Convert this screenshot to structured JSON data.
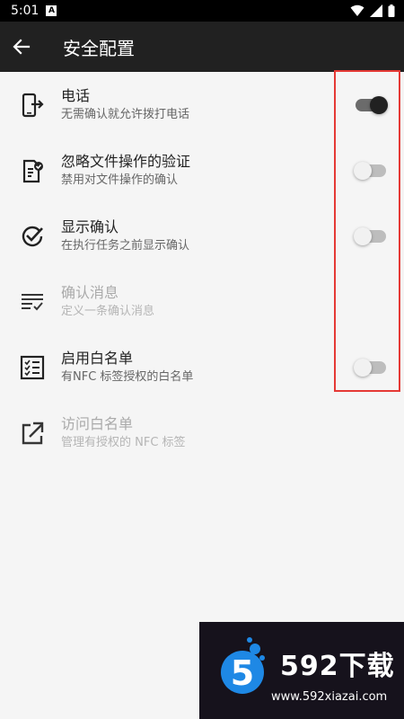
{
  "status_bar": {
    "time": "5:01",
    "app_icon_letter": "A"
  },
  "app_bar": {
    "title": "安全配置",
    "back_icon": "arrow-back-icon"
  },
  "settings": [
    {
      "title": "电话",
      "subtitle": "无需确认就允许拨打电话",
      "icon": "phone-forward-icon",
      "toggle": "on",
      "enabled": true
    },
    {
      "title": "忽略文件操作的验证",
      "subtitle": "禁用对文件操作的确认",
      "icon": "document-check-icon",
      "toggle": "off",
      "enabled": true
    },
    {
      "title": "显示确认",
      "subtitle": "在执行任务之前显示确认",
      "icon": "check-circle-icon",
      "toggle": "off",
      "enabled": true
    },
    {
      "title": "确认消息",
      "subtitle": "定义一条确认消息",
      "icon": "message-lines-icon",
      "toggle": null,
      "enabled": false
    },
    {
      "title": "启用白名单",
      "subtitle": "有NFC 标签授权的白名单",
      "icon": "checklist-icon",
      "toggle": "off",
      "enabled": true
    },
    {
      "title": "访问白名单",
      "subtitle": "管理有授权的 NFC 标签",
      "icon": "open-external-icon",
      "toggle": null,
      "enabled": false
    }
  ],
  "watermark": {
    "brand": "592下载",
    "url": "www.592xiazai.com",
    "logo_digit": "5"
  },
  "colors": {
    "app_bar": "#212121",
    "background": "#f5f5f5",
    "highlight": "#e53935"
  }
}
